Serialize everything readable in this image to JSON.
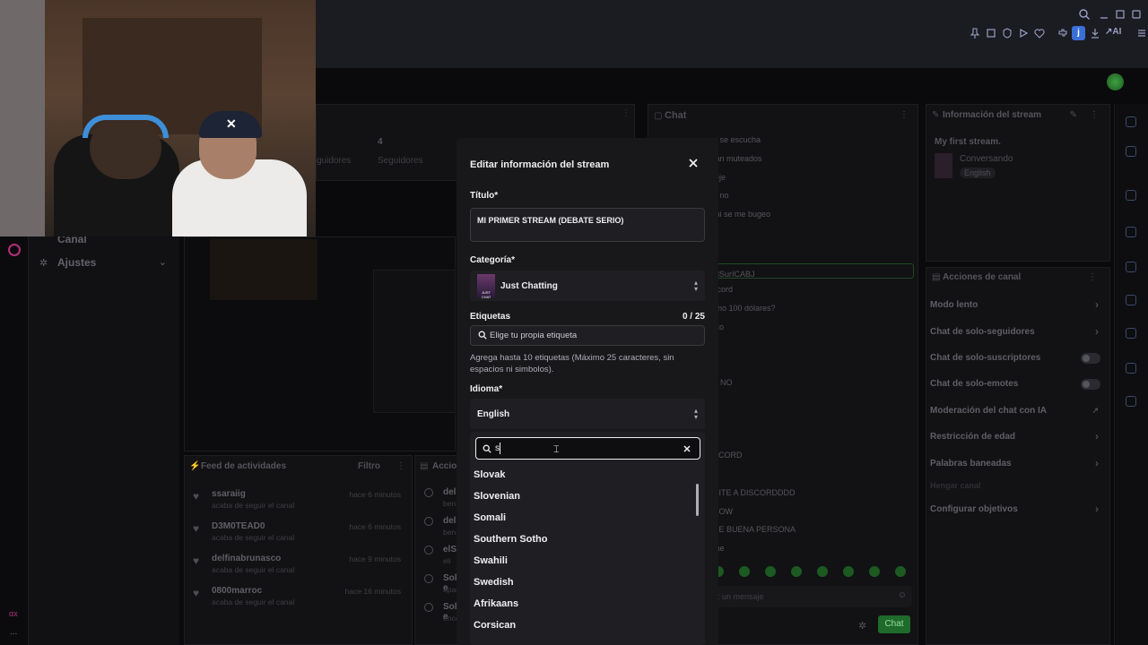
{
  "browser": {
    "ai_label": "AI",
    "profile_initial": "j"
  },
  "left_nav": {
    "canal_label": "Canal",
    "ajustes_label": "Ajustes",
    "rail_bottom_label": "αx",
    "rail_more": "..."
  },
  "stats": {
    "followers_count": "4",
    "followers_label": "Seguidores",
    "partial_label": "guidores"
  },
  "chat": {
    "title": "Chat",
    "lines": [
      "o se escucha",
      "tan muteados",
      "ieje",
      "n no",
      "mi se me bugeo",
      "elSurICABJ",
      "scord",
      "ono 100 dólares?",
      "sto",
      "NO",
      "SCORD",
      "N",
      "NITE A DISCORDDDD",
      "DOW",
      "UE BUENA PERSONA",
      "me"
    ],
    "input_placeholder": "a: un mensaje",
    "send_label": "Chat"
  },
  "stream_info": {
    "title": "Información del stream",
    "stream_title": "My first stream.",
    "category": "Conversando",
    "language": "English"
  },
  "channel_actions": {
    "title": "Acciones de canal",
    "items": [
      "Modo lento",
      "Chat de solo-seguidores",
      "Chat de solo-suscriptores",
      "Chat de solo-emotes",
      "Moderación del chat con IA",
      "Restricción de edad",
      "Palabras baneadas",
      "Hengar canal",
      "Configurar objetivos"
    ]
  },
  "activity_feed": {
    "title": "Feed de actividades",
    "filter_label": "Filtro",
    "items": [
      {
        "user": "ssaraiig",
        "action": "acaba de seguir el canal",
        "time": "hace 6 minutos"
      },
      {
        "user": "D3M0TEAD0",
        "action": "acaba de seguir el canal",
        "time": "hace 6 minutos"
      },
      {
        "user": "delfinabrunasco",
        "action": "acaba de seguir el canal",
        "time": "hace 9 minutos"
      },
      {
        "user": "0800marroc",
        "action": "acaba de seguir el canal",
        "time": "hace 16 minutos"
      }
    ]
  },
  "actions_panel": {
    "title": "Accio",
    "items": [
      {
        "label": "del",
        "sub": "ben"
      },
      {
        "label": "del",
        "sub": "ben"
      },
      {
        "label": "elS",
        "sub": "eli"
      },
      {
        "label": "Solo-e",
        "sub": "apagad"
      },
      {
        "label": "Solo-e",
        "sub": "encend"
      }
    ]
  },
  "modal": {
    "title": "Editar información del stream",
    "titulo_label": "Título*",
    "titulo_value": "MI PRIMER STREAM (DEBATE SERIO)",
    "categoria_label": "Categoría*",
    "categoria_value": "Just Chatting",
    "categoria_art_text": "JUST CHAT",
    "etiquetas_label": "Etiquetas",
    "etiquetas_count": "0 / 25",
    "etiquetas_placeholder": "Elige tu propia etiqueta",
    "etiquetas_help": "Agrega hasta 10 etiquetas (Máximo 25 caracteres, sin espacios ni simbolos).",
    "idioma_label": "Idioma*",
    "idioma_value": "English",
    "search_value": "s",
    "languages": [
      "Slovak",
      "Slovenian",
      "Somali",
      "Southern Sotho",
      "Swahili",
      "Swedish",
      "Afrikaans",
      "Corsican"
    ]
  }
}
